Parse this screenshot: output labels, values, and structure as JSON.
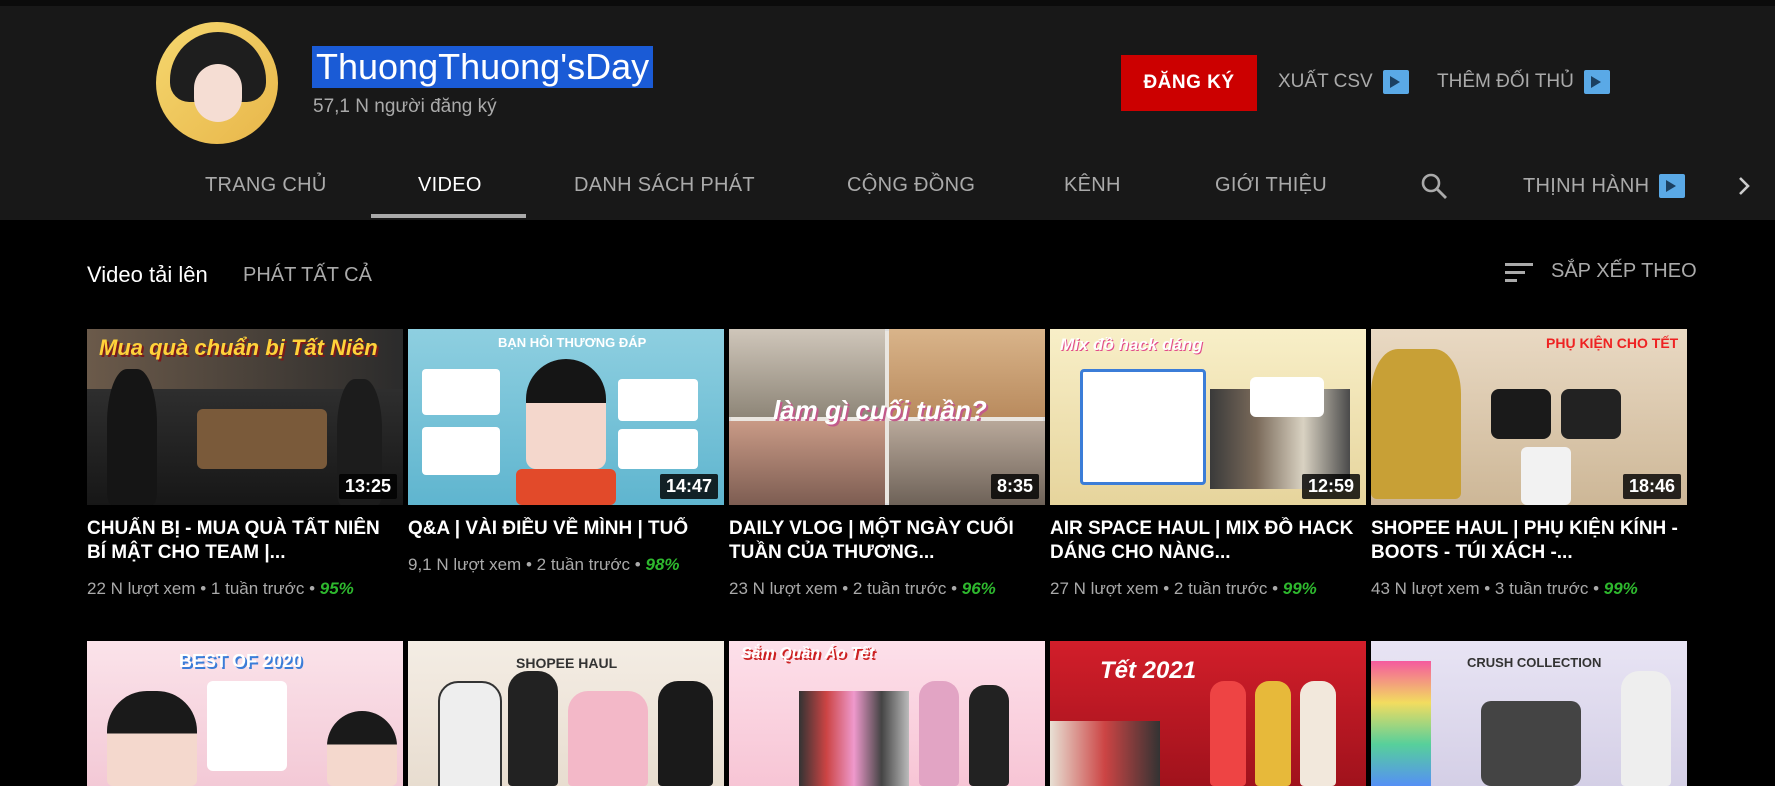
{
  "channel": {
    "name": "ThuongThuong'sDay",
    "subscribers": "57,1 N người đăng ký",
    "subscribe_label": "ĐĂNG KÝ",
    "export_csv": "XUẤT CSV",
    "add_competitor": "THÊM ĐỐI THỦ"
  },
  "tabs": [
    {
      "label": "TRANG CHỦ"
    },
    {
      "label": "VIDEO"
    },
    {
      "label": "DANH SÁCH PHÁT"
    },
    {
      "label": "CỘNG ĐỒNG"
    },
    {
      "label": "KÊNH"
    },
    {
      "label": "GIỚI THIỆU"
    },
    {
      "label": "THỊNH HÀNH"
    }
  ],
  "section": {
    "title": "Video tải lên",
    "play_all": "PHÁT TẤT CẢ",
    "sort_by": "SẮP XẾP THEO"
  },
  "videos": [
    {
      "title": "CHUẨN BỊ - MUA QUÀ TẤT NIÊN BÍ MẬT CHO TEAM |...",
      "duration": "13:25",
      "views": "22 N lượt xem",
      "age": "1 tuần trước",
      "pct": "95%",
      "overlay": "Mua quà chuẩn bị Tất Niên"
    },
    {
      "title": "Q&A | VÀI ĐIỀU VỀ MÌNH | TUỔ",
      "duration": "14:47",
      "views": "9,1 N lượt xem",
      "age": "2 tuần trước",
      "pct": "98%",
      "overlay": "BẠN HỎI THƯƠNG ĐÁP"
    },
    {
      "title": "DAILY VLOG | MỘT NGÀY CUỐI TUẦN CỦA THƯƠNG...",
      "duration": "8:35",
      "views": "23 N lượt xem",
      "age": "2 tuần trước",
      "pct": "96%",
      "overlay": "làm gì cuối tuần?"
    },
    {
      "title": "AIR SPACE HAUL | MIX ĐỒ HACK DÁNG CHO NÀNG...",
      "duration": "12:59",
      "views": "27 N lượt xem",
      "age": "2 tuần trước",
      "pct": "99%",
      "overlay": "Mix đồ hack dáng"
    },
    {
      "title": "SHOPEE HAUL | PHỤ KIỆN KÍNH - BOOTS - TÚI XÁCH -...",
      "duration": "18:46",
      "views": "43 N lượt xem",
      "age": "3 tuần trước",
      "pct": "99%",
      "overlay": "PHỤ KIỆN CHO TẾT"
    }
  ],
  "videos_row2": [
    {
      "overlay": "BEST OF 2020"
    },
    {
      "overlay": "SHOPEE HAUL"
    },
    {
      "overlay": "Sắm Quần Áo Tết"
    },
    {
      "overlay": "Tết 2021"
    },
    {
      "overlay": "CRUSH COLLECTION"
    }
  ],
  "meta_separator": "•",
  "colors": {
    "header_bg": "#181818",
    "subscribe_red": "#cc0000",
    "pct_green": "#2eb82e",
    "selection_blue": "#1a5bd6"
  }
}
